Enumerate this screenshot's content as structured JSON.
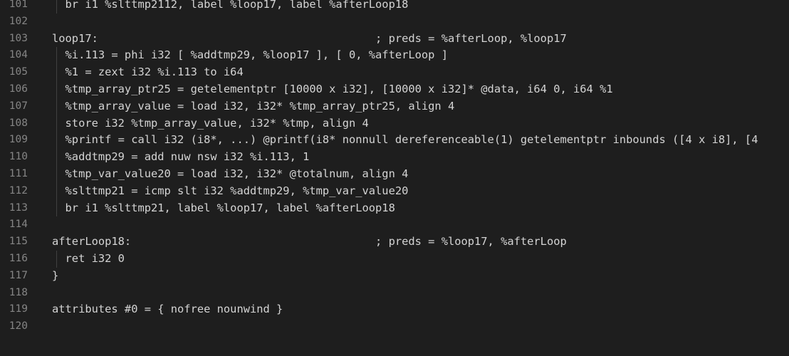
{
  "editor": {
    "lines": [
      {
        "num": "101",
        "text": "  br i1 %slttmp2112, label %loop17, label %afterLoop18",
        "indented": true
      },
      {
        "num": "102",
        "text": "",
        "indented": false
      },
      {
        "num": "103",
        "text": "loop17:                                          ; preds = %afterLoop, %loop17",
        "indented": false
      },
      {
        "num": "104",
        "text": "  %i.113 = phi i32 [ %addtmp29, %loop17 ], [ 0, %afterLoop ]",
        "indented": true
      },
      {
        "num": "105",
        "text": "  %1 = zext i32 %i.113 to i64",
        "indented": true
      },
      {
        "num": "106",
        "text": "  %tmp_array_ptr25 = getelementptr [10000 x i32], [10000 x i32]* @data, i64 0, i64 %1",
        "indented": true
      },
      {
        "num": "107",
        "text": "  %tmp_array_value = load i32, i32* %tmp_array_ptr25, align 4",
        "indented": true
      },
      {
        "num": "108",
        "text": "  store i32 %tmp_array_value, i32* %tmp, align 4",
        "indented": true
      },
      {
        "num": "109",
        "text": "  %printf = call i32 (i8*, ...) @printf(i8* nonnull dereferenceable(1) getelementptr inbounds ([4 x i8], [4",
        "indented": true
      },
      {
        "num": "110",
        "text": "  %addtmp29 = add nuw nsw i32 %i.113, 1",
        "indented": true
      },
      {
        "num": "111",
        "text": "  %tmp_var_value20 = load i32, i32* @totalnum, align 4",
        "indented": true
      },
      {
        "num": "112",
        "text": "  %slttmp21 = icmp slt i32 %addtmp29, %tmp_var_value20",
        "indented": true
      },
      {
        "num": "113",
        "text": "  br i1 %slttmp21, label %loop17, label %afterLoop18",
        "indented": true
      },
      {
        "num": "114",
        "text": "",
        "indented": false
      },
      {
        "num": "115",
        "text": "afterLoop18:                                     ; preds = %loop17, %afterLoop",
        "indented": false
      },
      {
        "num": "116",
        "text": "  ret i32 0",
        "indented": true
      },
      {
        "num": "117",
        "text": "}",
        "indented": false
      },
      {
        "num": "118",
        "text": "",
        "indented": false
      },
      {
        "num": "119",
        "text": "attributes #0 = { nofree nounwind }",
        "indented": false
      },
      {
        "num": "120",
        "text": "",
        "indented": false
      }
    ]
  }
}
